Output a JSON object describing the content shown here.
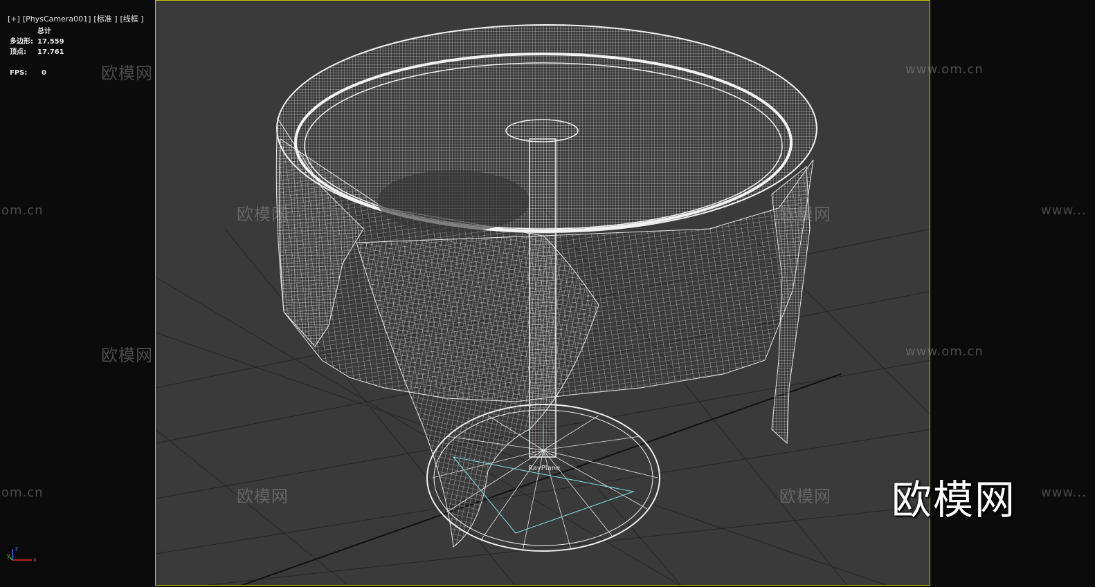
{
  "viewport": {
    "labels": [
      "[+]",
      "[PhysCamera001]",
      "[标准 ]",
      "[线框 ]"
    ],
    "object_label": "RayPlane"
  },
  "stats": {
    "header": "总计",
    "polygons_label": "多边形:",
    "polygons_value": "17.559",
    "vertices_label": "顶点:",
    "vertices_value": "17.761",
    "fps_label": "FPS:",
    "fps_value": "0"
  },
  "watermarks": {
    "brand": "欧模网",
    "url": "www.om.cn",
    "url_fragment": "om.cn",
    "url_prefix": "www..."
  },
  "axis": {
    "x": "x",
    "y": "y",
    "z": "z"
  },
  "colors": {
    "viewport_border": "#c8c800",
    "viewport_bg": "#3a3a3a",
    "wire": "#e8e8e8",
    "cyan": "#7fe0e0"
  }
}
